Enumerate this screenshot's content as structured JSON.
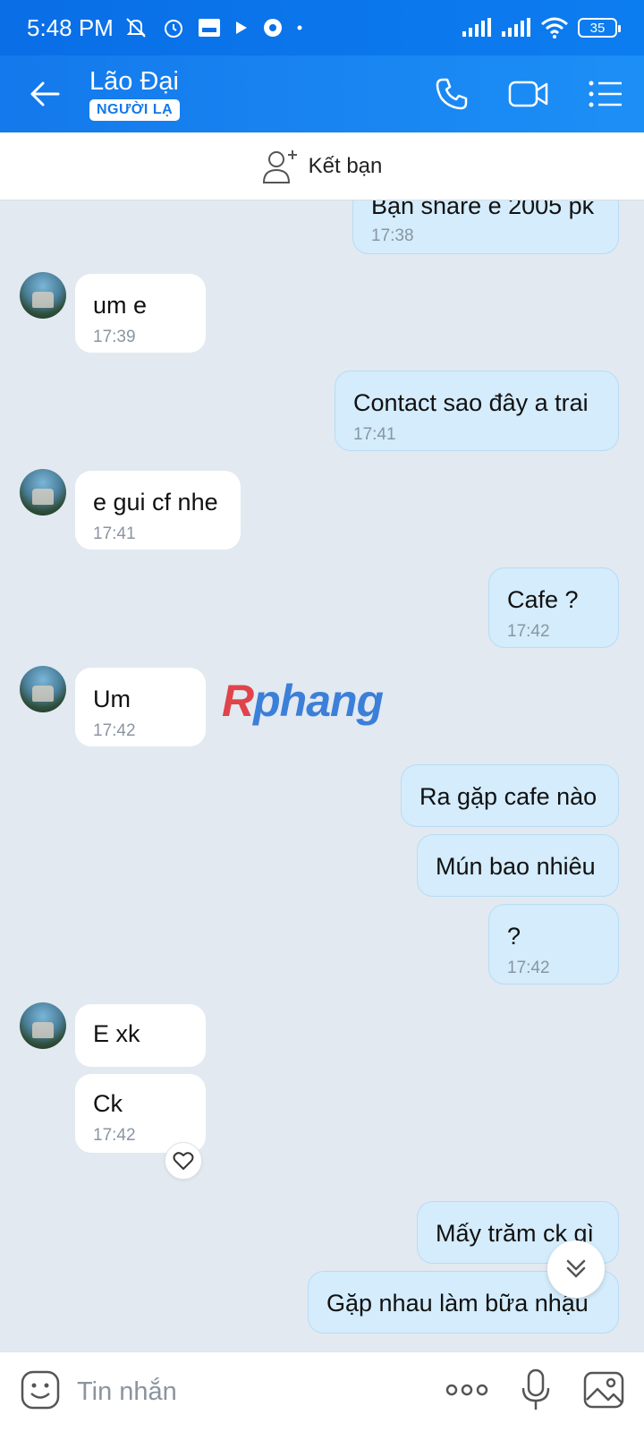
{
  "status_bar": {
    "time": "5:48 PM",
    "battery": "35",
    "icons": [
      "mute-icon",
      "alarm-icon",
      "pay-icon",
      "play-icon",
      "chrome-icon",
      "dot-icon",
      "signal-icon",
      "signal-icon",
      "wifi-icon",
      "battery-icon"
    ]
  },
  "header": {
    "contact_name": "Lão Đại",
    "badge": "NGƯỜI LẠ",
    "accent_color": "#1479ec"
  },
  "add_friend": {
    "label": "Kết bạn"
  },
  "messages": [
    {
      "dir": "out",
      "text": "Bạn share e 2005 pk",
      "time": "17:38"
    },
    {
      "dir": "in",
      "text": "um e",
      "time": "17:39"
    },
    {
      "dir": "out",
      "text": "Contact sao đây a trai",
      "time": "17:41"
    },
    {
      "dir": "in",
      "text": "e gui cf nhe",
      "time": "17:41"
    },
    {
      "dir": "out",
      "text": "Cafe ?",
      "time": "17:42"
    },
    {
      "dir": "in",
      "text": "Um",
      "time": "17:42"
    },
    {
      "dir": "out",
      "text": "Ra gặp cafe nào",
      "time": ""
    },
    {
      "dir": "out",
      "text": "Mún bao nhiêu",
      "time": ""
    },
    {
      "dir": "out",
      "text": "?",
      "time": "17:42"
    },
    {
      "dir": "in",
      "text": "E xk",
      "time": ""
    },
    {
      "dir": "in",
      "text": "Ck",
      "time": "17:42"
    },
    {
      "dir": "out",
      "text": "Mấy trăm ck gì",
      "time": ""
    },
    {
      "dir": "out",
      "text": "Gặp nhau làm bữa nhậu",
      "time": ""
    }
  ],
  "watermark": {
    "first": "R",
    "rest": "phang"
  },
  "input": {
    "placeholder": "Tin nhắn"
  }
}
